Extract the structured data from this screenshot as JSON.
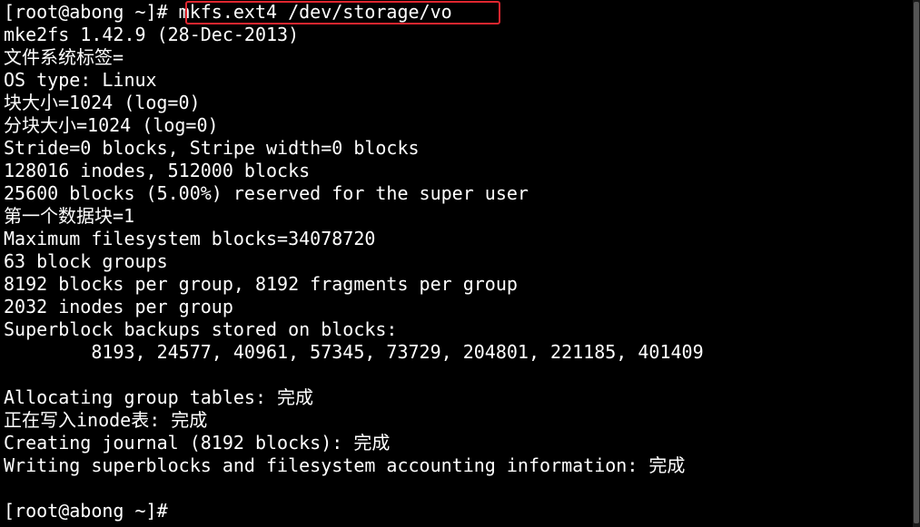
{
  "terminal": {
    "prompt_first": "[root@abong ~]# ",
    "command": "mkfs.ext4 /dev/storage/vo",
    "lines": [
      "mke2fs 1.42.9 (28-Dec-2013)",
      "文件系统标签=",
      "OS type: Linux",
      "块大小=1024 (log=0)",
      "分块大小=1024 (log=0)",
      "Stride=0 blocks, Stripe width=0 blocks",
      "128016 inodes, 512000 blocks",
      "25600 blocks (5.00%) reserved for the super user",
      "第一个数据块=1",
      "Maximum filesystem blocks=34078720",
      "63 block groups",
      "8192 blocks per group, 8192 fragments per group",
      "2032 inodes per group",
      "Superblock backups stored on blocks:",
      "        8193, 24577, 40961, 57345, 73729, 204801, 221185, 401409",
      "",
      "Allocating group tables: 完成",
      "正在写入inode表: 完成",
      "Creating journal (8192 blocks): 完成",
      "Writing superblocks and filesystem accounting information: 完成",
      ""
    ],
    "prompt_last": "[root@abong ~]# "
  },
  "colors": {
    "background": "#000000",
    "foreground": "#ffffff",
    "highlight_box": "#e0262f"
  }
}
